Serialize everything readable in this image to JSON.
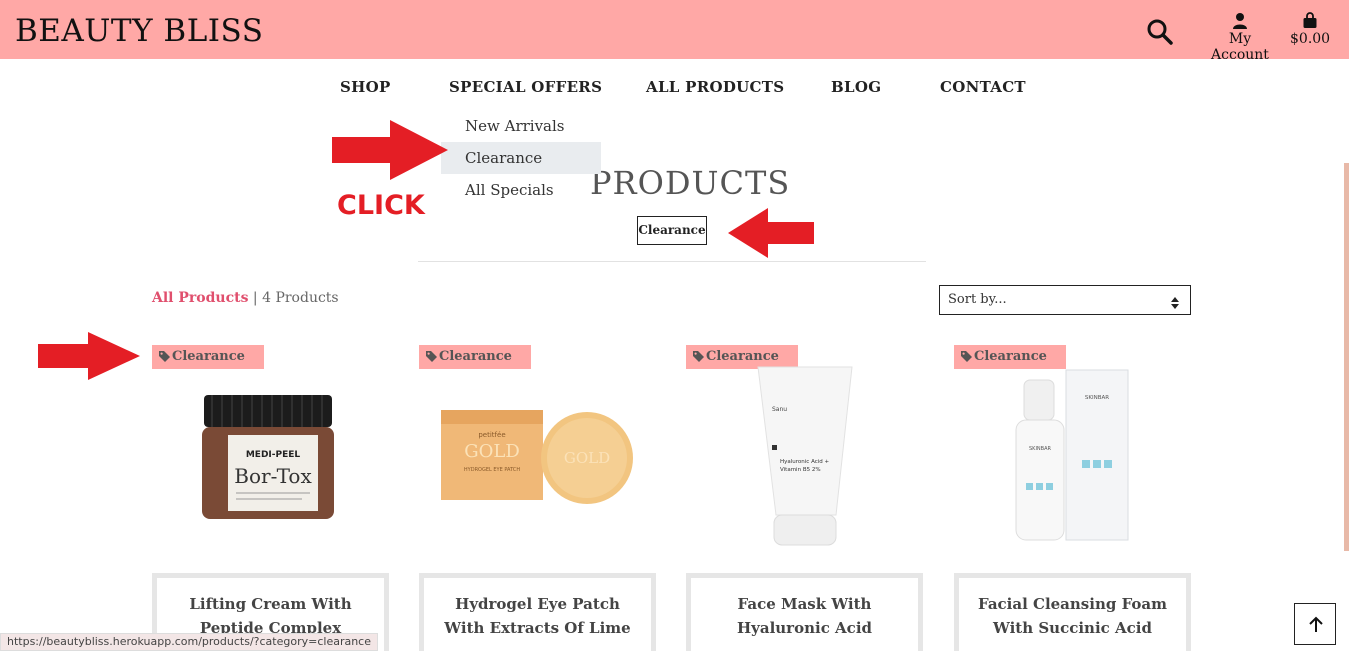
{
  "header": {
    "logo": "BEAUTY BLISS",
    "account_label": "My Account",
    "cart_total": "$0.00",
    "bg_color": "#ffa8a6"
  },
  "nav": {
    "items": [
      "SHOP",
      "SPECIAL OFFERS",
      "ALL PRODUCTS",
      "BLOG",
      "CONTACT"
    ]
  },
  "dropdown": {
    "items": [
      "New Arrivals",
      "Clearance",
      "All Specials"
    ],
    "active": "Clearance"
  },
  "annotation": {
    "click_label": "CLICK",
    "arrow_color": "#e41e25"
  },
  "page": {
    "heading": "PRODUCTS",
    "filter_tag": "Clearance",
    "all_products_link": "All Products",
    "count_text": " | 4 Products",
    "sort_placeholder": "Sort by..."
  },
  "products": [
    {
      "badge": "Clearance",
      "name": "Lifting Cream With Peptide Complex"
    },
    {
      "badge": "Clearance",
      "name": "Hydrogel Eye Patch With Extracts Of Lime"
    },
    {
      "badge": "Clearance",
      "name": "Face Mask With Hyaluronic Acid"
    },
    {
      "badge": "Clearance",
      "name": "Facial Cleansing Foam With Succinic Acid"
    }
  ],
  "product_image_text": {
    "cream_brand": "MEDI-PEEL",
    "cream_name": "Bor-Tox",
    "patch_brand": "petitfée",
    "patch_name": "GOLD",
    "patch_sub": "HYDROGEL EYE PATCH",
    "tube_brand": "Sanu",
    "tube_text": "Hyaluronic Acid + Vitamin B5 2%",
    "foam_brand": "SKINBAR"
  },
  "status_bar": {
    "url": "https://beautybliss.herokuapp.com/products/?category=clearance"
  }
}
